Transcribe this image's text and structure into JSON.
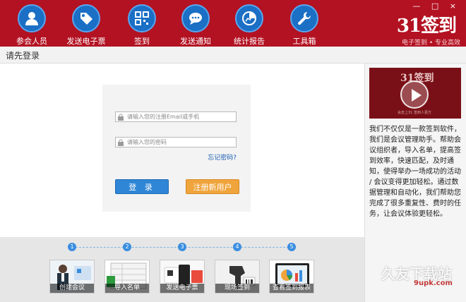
{
  "nav": {
    "items": [
      {
        "label": "参会人员",
        "icon": "user-icon"
      },
      {
        "label": "发送电子票",
        "icon": "ticket-icon"
      },
      {
        "label": "签到",
        "icon": "qrcode-icon"
      },
      {
        "label": "发送通知",
        "icon": "chat-icon"
      },
      {
        "label": "统计报告",
        "icon": "chart-icon"
      },
      {
        "label": "工具箱",
        "icon": "wrench-icon"
      }
    ]
  },
  "brand": {
    "logo": "31签到",
    "slogan": "电子签到 • 专业高效"
  },
  "window_controls": "— □ ×",
  "page_title": "请先登录",
  "login": {
    "email_placeholder": "请输入您的注册Email或手机",
    "password_placeholder": "请输入您的密码",
    "forgot": "忘记密码?",
    "login_button": "登 录",
    "register_button": "注册新用户"
  },
  "side": {
    "video_logo": "31签到",
    "video_caption": "会去上31 签到人更方",
    "description": "我们不仅仅是一款签到软件，我们是会议管理助手。帮助会议组织者，导入名单，提高签到效率，快速匹配，及时通知，使得举办一场成功的活动 / 会议变得更加轻松。通过数据管理和自动化，我们帮助您完成了很多重复性、费时的任务，让会议体验更轻松。"
  },
  "steps": [
    {
      "num": "1",
      "label": "创建会议"
    },
    {
      "num": "2",
      "label": "导入名单"
    },
    {
      "num": "3",
      "label": "发送电子票"
    },
    {
      "num": "4",
      "label": "现场签到"
    },
    {
      "num": "5",
      "label": "查看签到报表"
    }
  ],
  "watermark": {
    "text": "久友下载站",
    "sub": "9upk.com"
  },
  "colors": {
    "header": "#b31222",
    "nav_circle": "#1b6fc5",
    "login_button": "#2f86d6",
    "register_button": "#f0a43c"
  }
}
